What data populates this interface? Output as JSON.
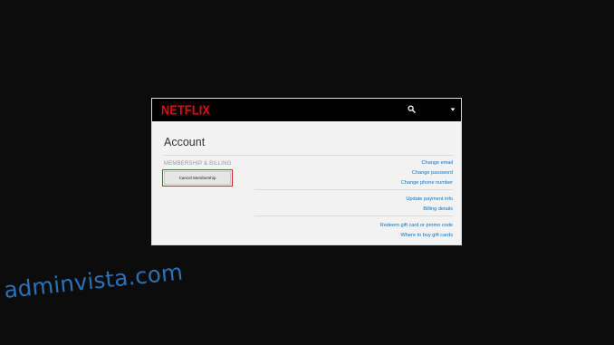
{
  "app": {
    "brand": "NETFLIX",
    "brand_color": "#e50914"
  },
  "topbar": {
    "search_icon": "search-icon",
    "profile_menu_icon": "caret-down-icon"
  },
  "account": {
    "title": "Account",
    "section_label": "MEMBERSHIP & BILLING",
    "cancel_button_label": "Cancel Membership",
    "highlight_color": "#d2232a",
    "link_groups": [
      [
        "Change email",
        "Change password",
        "Change phone number"
      ],
      [
        "Update payment info",
        "Billing details"
      ],
      [
        "Redeem gift card or promo code",
        "Where to buy gift cards"
      ]
    ],
    "link_color": "#0073cf"
  },
  "watermark": {
    "text": "adminvista.com",
    "color": "#2a72b8"
  }
}
